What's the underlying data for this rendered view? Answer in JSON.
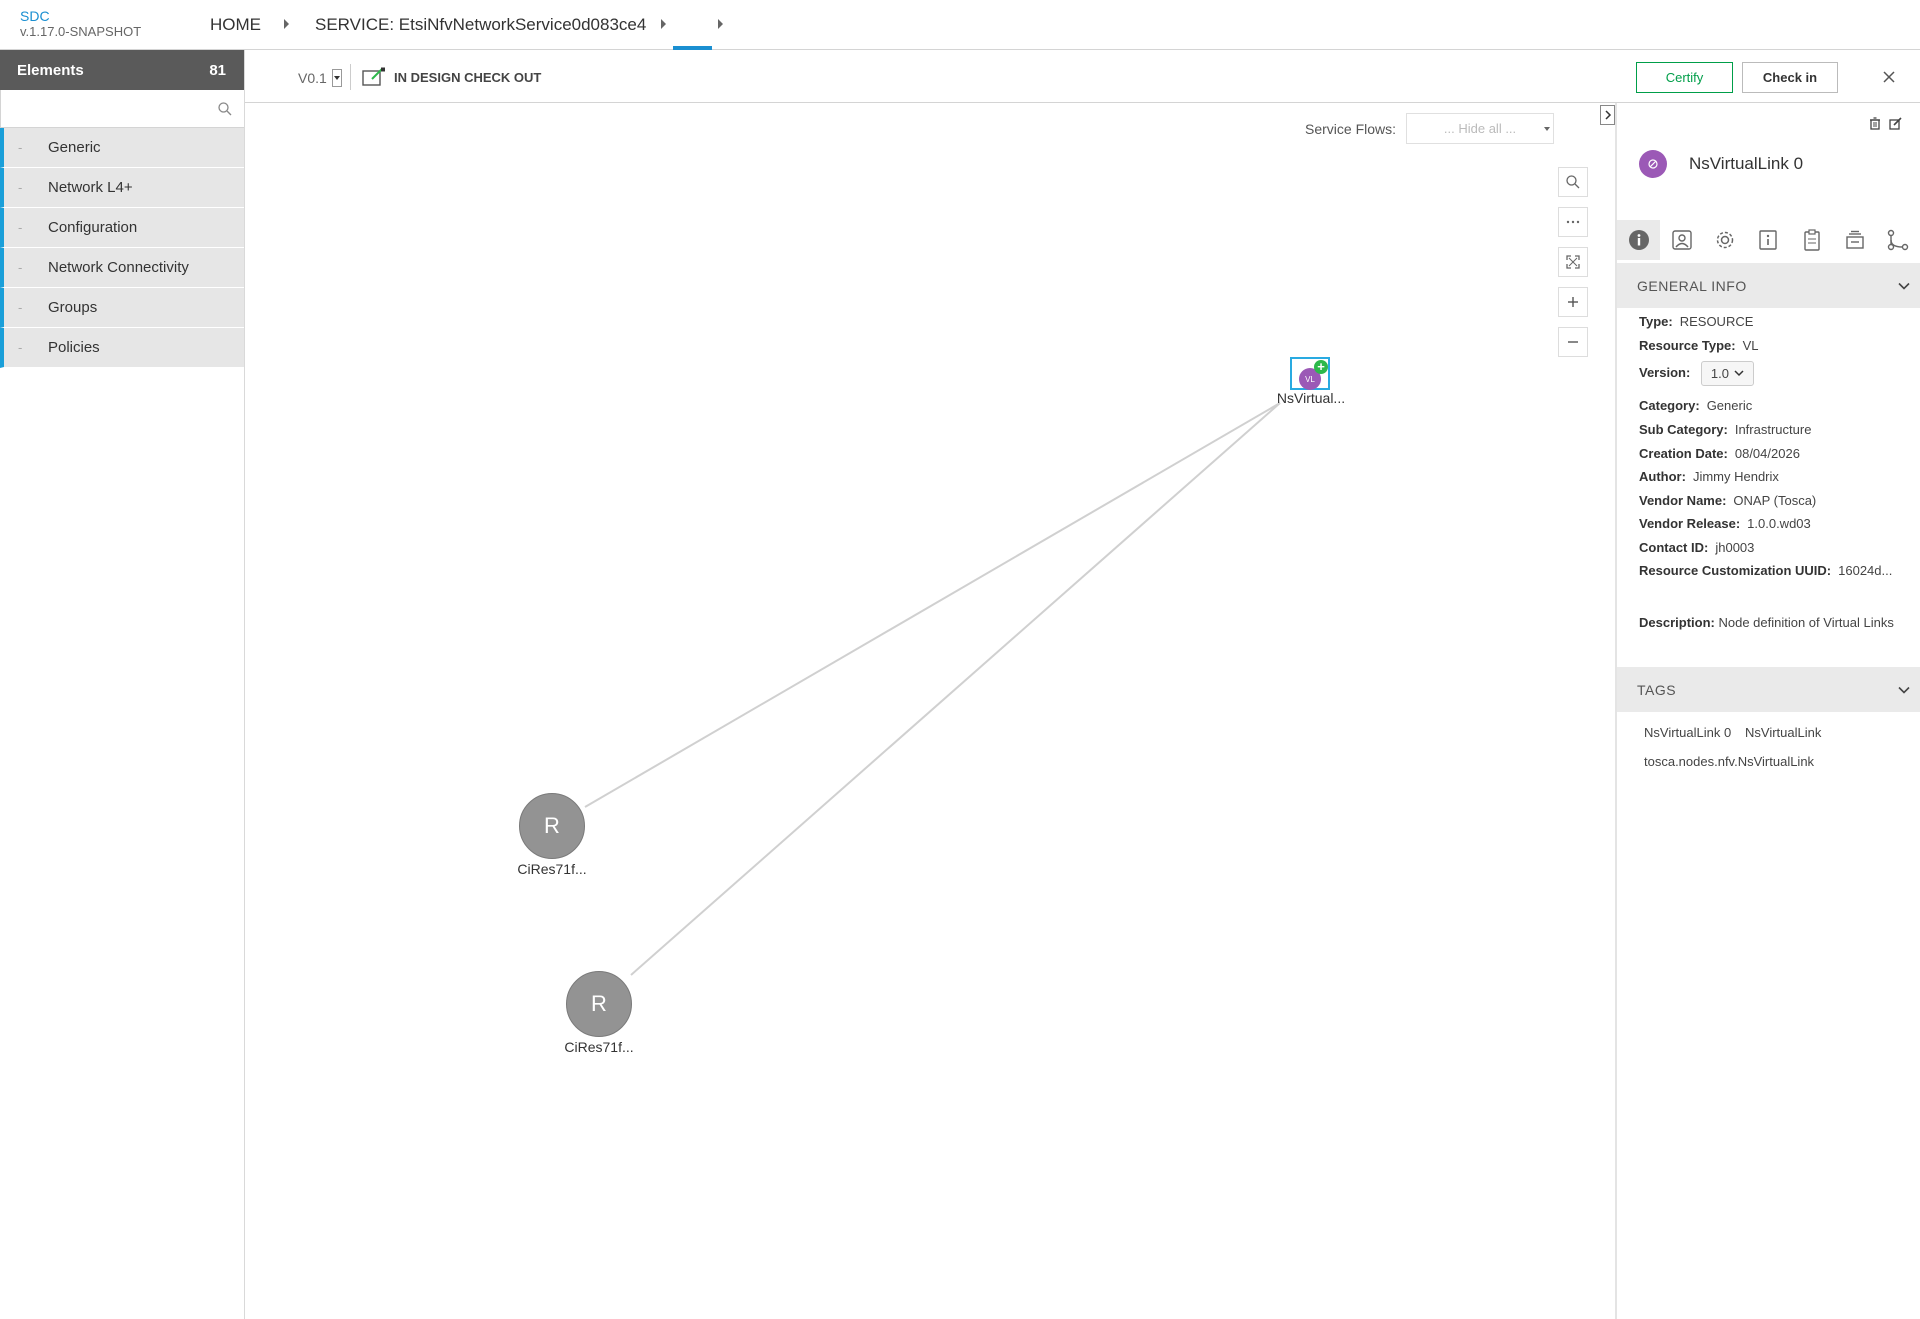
{
  "header": {
    "brand_name": "SDC",
    "brand_version": "v.1.17.0-SNAPSHOT",
    "breadcrumb": [
      "HOME",
      "SERVICE: EtsiNfvNetworkService0d083ce4",
      ""
    ]
  },
  "palette": {
    "title": "Elements",
    "count": "81",
    "search_placeholder": "",
    "items": [
      {
        "label": "Generic"
      },
      {
        "label": "Network L4+"
      },
      {
        "label": "Configuration"
      },
      {
        "label": "Network Connectivity"
      },
      {
        "label": "Groups"
      },
      {
        "label": "Policies"
      }
    ],
    "accent_color": "#1a9fd9"
  },
  "toolbar": {
    "version": "V0.1",
    "lifecycle_status": "IN DESIGN CHECK OUT",
    "certify_label": "Certify",
    "checkin_label": "Check in"
  },
  "canvas": {
    "service_flows_label": "Service Flows:",
    "service_flows_value": "... Hide all ...",
    "nodes": [
      {
        "id": "vl",
        "icon_text": "VL",
        "label": "NsVirtual..."
      },
      {
        "id": "r1",
        "icon_text": "R",
        "label": "CiRes71f..."
      },
      {
        "id": "r2",
        "icon_text": "R",
        "label": "CiRes71f..."
      }
    ]
  },
  "details": {
    "title": "NsVirtualLink 0",
    "general_info_title": "GENERAL INFO",
    "fields": {
      "type_label": "Type:",
      "type_value": "RESOURCE",
      "resource_type_label": "Resource Type:",
      "resource_type_value": "VL",
      "version_label": "Version:",
      "version_value": "1.0",
      "category_label": "Category:",
      "category_value": "Generic",
      "sub_category_label": "Sub Category:",
      "sub_category_value": "Infrastructure",
      "creation_date_label": "Creation Date:",
      "creation_date_value": "08/04/2026",
      "author_label": "Author:",
      "author_value": "Jimmy Hendrix",
      "vendor_name_label": "Vendor Name:",
      "vendor_name_value": "ONAP (Tosca)",
      "vendor_release_label": "Vendor Release:",
      "vendor_release_value": "1.0.0.wd03",
      "contact_id_label": "Contact ID:",
      "contact_id_value": "jh0003",
      "uuid_label": "Resource Customization UUID:",
      "uuid_value": "16024d..."
    },
    "description_label": "Description:",
    "description_value": "Node definition of Virtual Links",
    "tags_title": "TAGS",
    "tags": [
      "NsVirtualLink 0",
      "NsVirtualLink",
      "tosca.nodes.nfv.NsVirtualLink"
    ]
  }
}
